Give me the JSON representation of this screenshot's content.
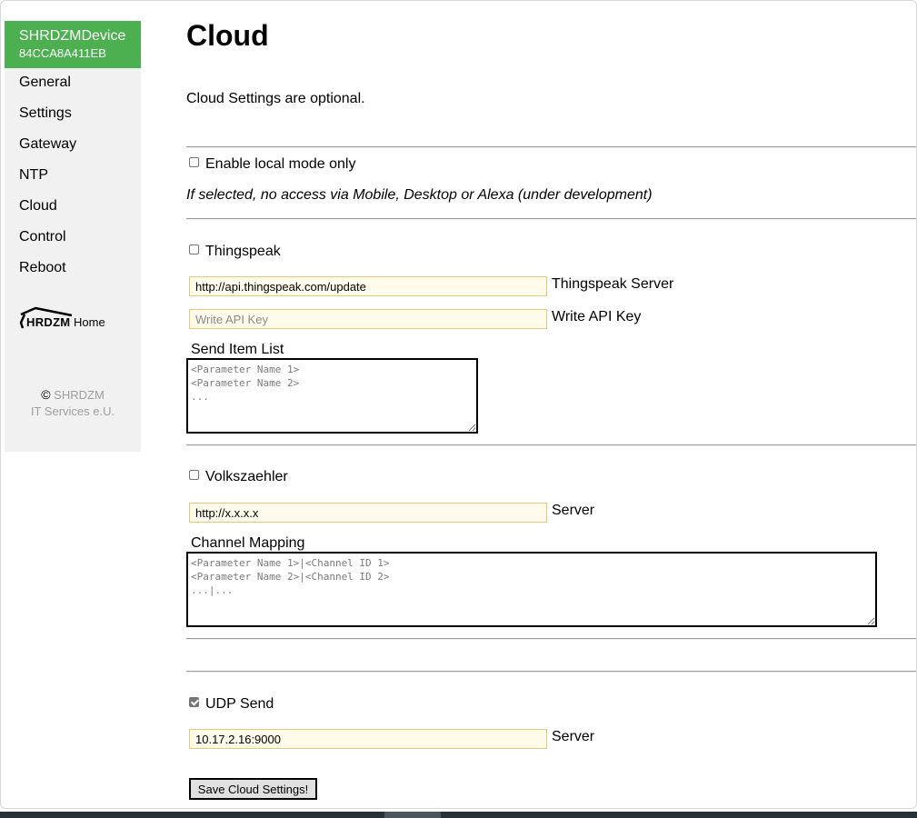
{
  "sidebar": {
    "device_name": "SHRDZMDevice",
    "device_id": "84CCA8A411EB",
    "nav": [
      "General",
      "Settings",
      "Gateway",
      "NTP",
      "Cloud",
      "Control",
      "Reboot"
    ],
    "logo_text": "HRDZM",
    "home_label": "Home",
    "copyright_symbol": "©",
    "copyright_line1": "SHRDZM",
    "copyright_line2": "IT Services e.U.",
    "accent_color": "#4caf50"
  },
  "main": {
    "title": "Cloud",
    "intro": "Cloud Settings are optional.",
    "local_mode": {
      "label": "Enable local mode only",
      "checked": false,
      "note": "If selected, no access via Mobile, Desktop or Alexa (under development)"
    },
    "thingspeak": {
      "label": "Thingspeak",
      "checked": false,
      "server_value": "http://api.thingspeak.com/update",
      "server_label": "Thingspeak Server",
      "api_key_value": "",
      "api_key_placeholder": "Write API Key",
      "api_key_label": "Write API Key",
      "item_list_label": "Send Item List",
      "item_list_placeholder": "<Parameter Name 1>\n<Parameter Name 2>\n..."
    },
    "volkszaehler": {
      "label": "Volkszaehler",
      "checked": false,
      "server_value": "http://x.x.x.x",
      "server_label": "Server",
      "mapping_label": "Channel Mapping",
      "mapping_placeholder": "<Parameter Name 1>|<Channel ID 1>\n<Parameter Name 2>|<Channel ID 2>\n...|..."
    },
    "udp": {
      "label": "UDP Send",
      "checked": true,
      "server_value": "10.17.2.16:9000",
      "server_label": "Server"
    },
    "save_label": "Save Cloud Settings!"
  }
}
